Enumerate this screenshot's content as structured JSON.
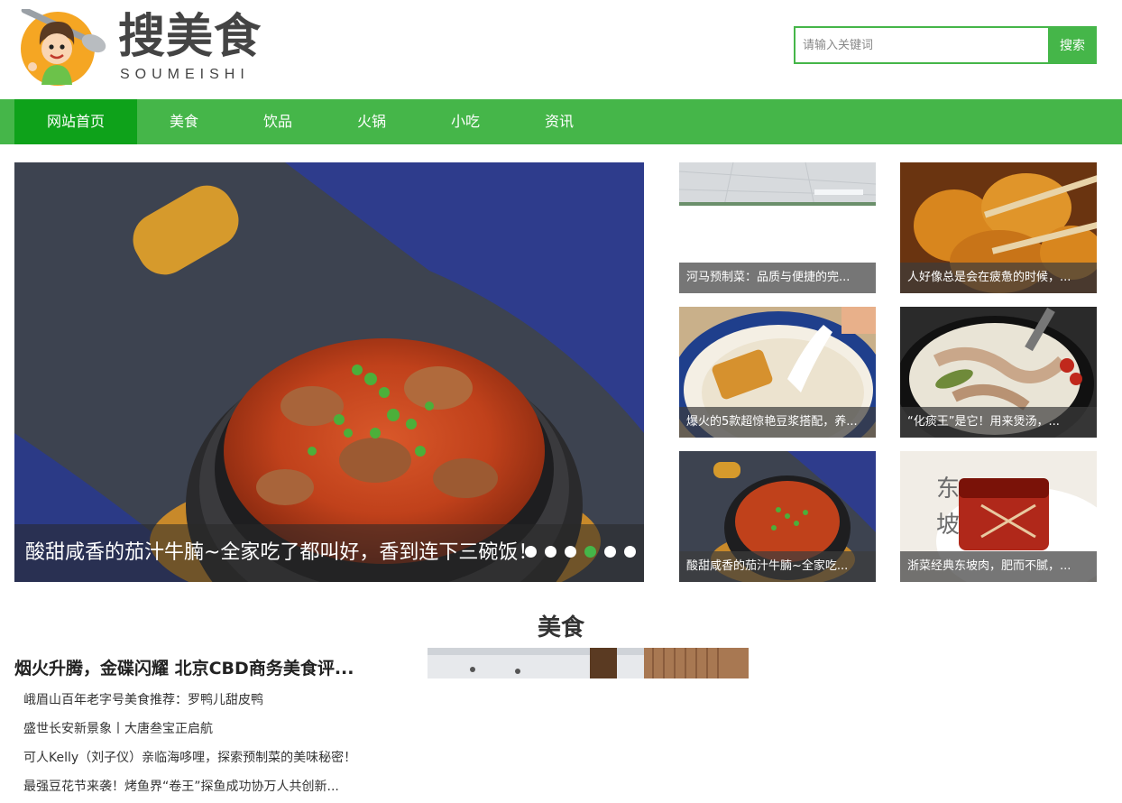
{
  "logo": {
    "title": "搜美食",
    "subtitle": "SOUMEISHI"
  },
  "search": {
    "placeholder": "请输入关键词",
    "value": "",
    "button_label": "搜索"
  },
  "nav": {
    "items": [
      {
        "label": "网站首页",
        "active": true
      },
      {
        "label": "美食",
        "active": false
      },
      {
        "label": "饮品",
        "active": false
      },
      {
        "label": "火锅",
        "active": false
      },
      {
        "label": "小吃",
        "active": false
      },
      {
        "label": "资讯",
        "active": false
      }
    ]
  },
  "hero": {
    "caption": "酸甜咸香的茄汁牛腩~全家吃了都叫好，香到连下三碗饭！",
    "slide_count": 6,
    "active_slide": 3
  },
  "thumbs": [
    {
      "caption": "河马预制菜：品质与便捷的完..."
    },
    {
      "caption": "人好像总是会在疲惫的时候，..."
    },
    {
      "caption": "爆火的5款超惊艳豆浆搭配，养..."
    },
    {
      "caption": "“化痰王”是它！用来煲汤，..."
    },
    {
      "caption": "酸甜咸香的茄汁牛腩~全家吃..."
    },
    {
      "caption": "浙菜经典东坡肉，肥而不腻，..."
    }
  ],
  "section": {
    "title": "美食",
    "headline": "烟火升腾，金碟闪耀 北京CBD商务美食评...",
    "items": [
      "峨眉山百年老字号美食推荐：罗鸭儿甜皮鸭",
      "盛世长安新景象丨大唐叁宝正启航",
      "可人Kelly（刘子仪）亲临海哆哩，探索预制菜的美味秘密！",
      "最强豆花节来袭！烤鱼界“卷王”探鱼成功协万人共创新..."
    ]
  },
  "colors": {
    "brand_green": "#45b649",
    "nav_active": "#0ea21a"
  }
}
